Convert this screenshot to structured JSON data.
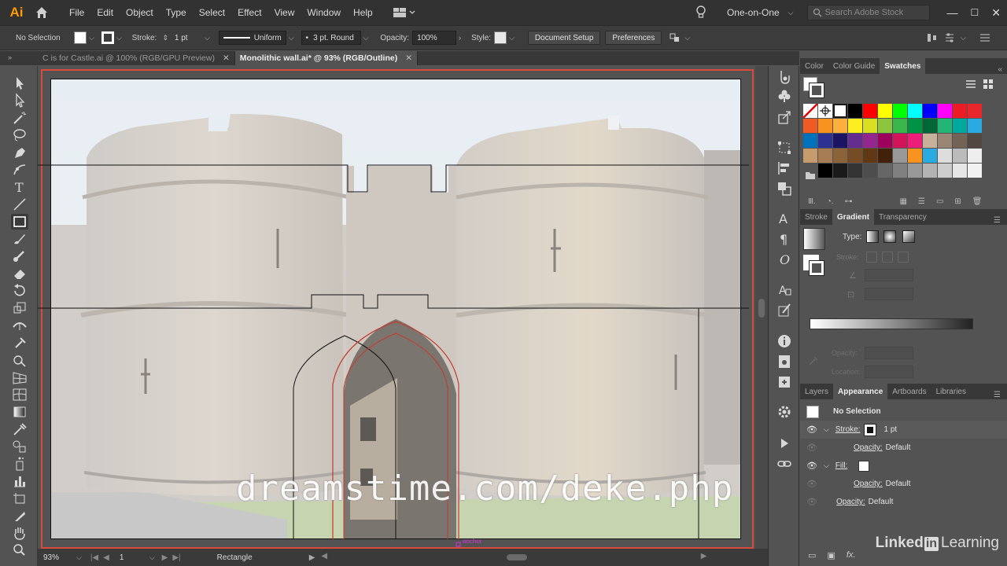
{
  "app": {
    "logo": "Ai",
    "icon_home": "home-icon"
  },
  "menu": [
    "File",
    "Edit",
    "Object",
    "Type",
    "Select",
    "Effect",
    "View",
    "Window",
    "Help"
  ],
  "menu_right": {
    "workspace": "One-on-One",
    "search_placeholder": "Search Adobe Stock"
  },
  "control": {
    "selection": "No Selection",
    "stroke_label": "Stroke:",
    "stroke_weight": "1 pt",
    "stroke_profile": "Uniform",
    "brush": "3 pt. Round",
    "opacity_label": "Opacity:",
    "opacity_value": "100%",
    "style_label": "Style:",
    "document_setup": "Document Setup",
    "preferences": "Preferences"
  },
  "tabs": [
    {
      "label": "C is for Castle.ai @ 100% (RGB/GPU Preview)",
      "close": "✕"
    },
    {
      "label": "Monolithic wall.ai* @ 93% (RGB/Outline)",
      "close": "✕"
    }
  ],
  "canvas": {
    "watermark": "dreamstime.com/deke.php",
    "anchor_hint": "anchor"
  },
  "status": {
    "zoom": "93%",
    "artboard_num": "1",
    "tool": "Rectangle"
  },
  "swatches_panel": {
    "tabs": [
      "Color",
      "Color Guide",
      "Swatches"
    ],
    "active": "Swatches",
    "rows": [
      [
        "#ffffff",
        "#ffffff",
        "#ffffff",
        "#000000",
        "#ff0000",
        "#ffff00",
        "#00ff00",
        "#00ffff",
        "#0000ff",
        "#ff00ff",
        "#ed1c24",
        "#e8262b"
      ],
      [
        "#f15a24",
        "#f7931e",
        "#fbb03b",
        "#fcee21",
        "#d9e021",
        "#8cc63f",
        "#39b54a",
        "#009245",
        "#006837",
        "#22b573",
        "#00a99d",
        "#29abe2"
      ],
      [
        "#0071bc",
        "#2e3192",
        "#1b1464",
        "#662d91",
        "#93278f",
        "#9e005d",
        "#d4145a",
        "#ed1e79",
        "#c7b299",
        "#998675",
        "#736357",
        "#534741"
      ],
      [
        "#c69c6d",
        "#a67c52",
        "#8c6239",
        "#754c24",
        "#603813",
        "#42210b",
        "#999999",
        "#f7931e",
        "#29abe2",
        "#dddddd",
        "#bbbbbb",
        "#eeeeee"
      ],
      [
        "#555555",
        "#000000",
        "#1a1a1a",
        "#333333",
        "#4d4d4d",
        "#666666",
        "#808080",
        "#999999",
        "#b3b3b3",
        "#cccccc",
        "#e6e6e6",
        "#f2f2f2"
      ]
    ]
  },
  "gradient_panel": {
    "tabs": [
      "Stroke",
      "Gradient",
      "Transparency"
    ],
    "active": "Gradient",
    "type_label": "Type:",
    "stroke_label": "Stroke:",
    "opacity_label": "Opacity:",
    "location_label": "Location:"
  },
  "appearance_panel": {
    "tabs": [
      "Layers",
      "Appearance",
      "Artboards",
      "Libraries"
    ],
    "active": "Appearance",
    "title": "No Selection",
    "stroke_label": "Stroke:",
    "stroke_value": "1 pt",
    "opacity_label": "Opacity:",
    "opacity_value": "Default",
    "fill_label": "Fill:",
    "opacity2_label": "Opacity:",
    "opacity2_value": "Default",
    "opacity3_label": "Opacity:",
    "opacity3_value": "Default",
    "fx_label": "fx."
  },
  "branding": {
    "linked": "Linked",
    "in": "in",
    "learning": "Learning"
  }
}
